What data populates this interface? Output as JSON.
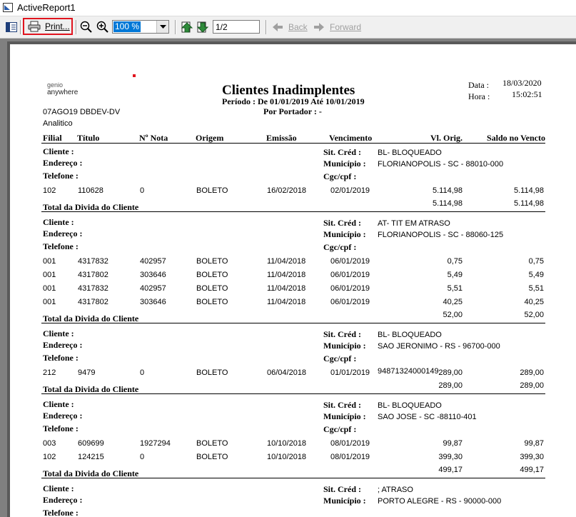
{
  "window": {
    "title": "ActiveReport1"
  },
  "toolbar": {
    "print_label": "Print...",
    "zoom_value": "100 %",
    "page_value": "1/2",
    "back_label": "Back",
    "forward_label": "Forward"
  },
  "report": {
    "logo_line1": "genio",
    "logo_line2": "anywhere",
    "code_line": "07AGO19 DBDEV-DV",
    "mode": "Analitico",
    "title": "Clientes Inadimplentes",
    "periodo_label": "Período  :  De 01/01/2019  Até  10/01/2019",
    "portador_label": "Por  Portador  :  -",
    "data_label": "Data  :",
    "data_value": "18/03/2020",
    "hora_label": "Hora  :",
    "hora_value": "15:02:51",
    "columns": [
      "Filial",
      "Título",
      "Nº Nota",
      "Origem",
      "Emissão",
      "Vencimento",
      "Vl. Orig.",
      "Saldo no Vencto"
    ],
    "labels": {
      "cliente": "Cliente  :",
      "endereco": "Endereço  :",
      "telefone": "Telefone  :",
      "sit_cred": "Sit. Créd  :",
      "municipio": "Município  :",
      "cgc": "Cgc/cpf  :",
      "total": "Total da Divida do Cliente"
    },
    "clients": [
      {
        "sit": "BL- BLOQUEADO",
        "municipio": "FLORIANOPOLIS - SC - 88010-000",
        "cgc": "",
        "rows": [
          [
            "102",
            "110628",
            "0",
            "BOLETO",
            "16/02/2018",
            "02/01/2019",
            "5.114,98",
            "5.114,98"
          ]
        ],
        "total_orig": "5.114,98",
        "total_saldo": "5.114,98"
      },
      {
        "sit": "AT- TIT EM ATRASO",
        "municipio": "FLORIANOPOLIS - SC - 88060-125",
        "cgc": "",
        "rows": [
          [
            "001",
            "4317832",
            "402957",
            "BOLETO",
            "11/04/2018",
            "06/01/2019",
            "0,75",
            "0,75"
          ],
          [
            "001",
            "4317802",
            "303646",
            "BOLETO",
            "11/04/2018",
            "06/01/2019",
            "5,49",
            "5,49"
          ],
          [
            "001",
            "4317832",
            "402957",
            "BOLETO",
            "11/04/2018",
            "06/01/2019",
            "5,51",
            "5,51"
          ],
          [
            "001",
            "4317802",
            "303646",
            "BOLETO",
            "11/04/2018",
            "06/01/2019",
            "40,25",
            "40,25"
          ]
        ],
        "total_orig": "52,00",
        "total_saldo": "52,00"
      },
      {
        "sit": "BL- BLOQUEADO",
        "municipio": "SAO JERONIMO - RS - 96700-000",
        "cgc": "94871324000149",
        "rows": [
          [
            "212",
            "9479",
            "0",
            "BOLETO",
            "06/04/2018",
            "01/01/2019",
            "289,00",
            "289,00"
          ]
        ],
        "total_orig": "289,00",
        "total_saldo": "289,00"
      },
      {
        "sit": "BL- BLOQUEADO",
        "municipio": "SAO JOSE - SC -88110-401",
        "cgc": "",
        "rows": [
          [
            "003",
            "609699",
            "1927294",
            "BOLETO",
            "10/10/2018",
            "08/01/2019",
            "99,87",
            "99,87"
          ],
          [
            "102",
            "124215",
            "0",
            "BOLETO",
            "10/10/2018",
            "08/01/2019",
            "399,30",
            "399,30"
          ]
        ],
        "total_orig": "499,17",
        "total_saldo": "499,17"
      },
      {
        "sit": "; ATRASO",
        "municipio": "PORTO ALEGRE - RS - 90000-000",
        "cgc": "",
        "rows": [],
        "total_orig": "",
        "total_saldo": ""
      }
    ]
  }
}
